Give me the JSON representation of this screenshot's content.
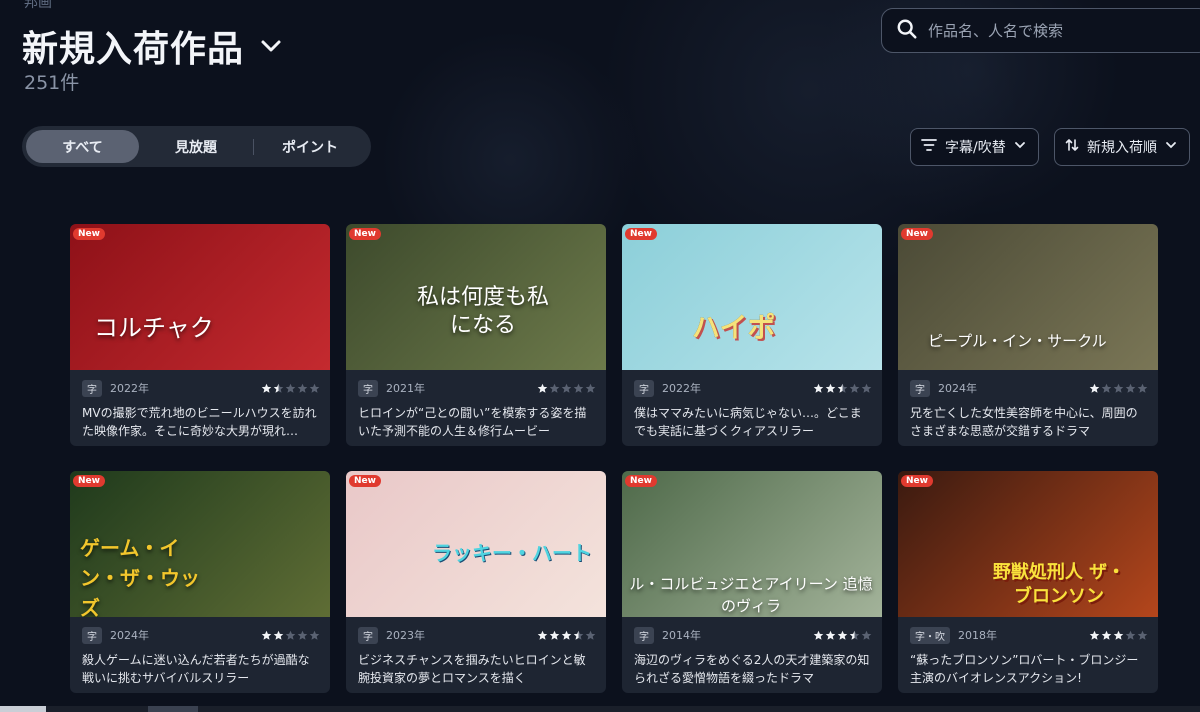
{
  "header": {
    "crumb": "邦画",
    "title": "新規入荷作品",
    "count": "251件"
  },
  "search": {
    "placeholder": "作品名、人名で検索"
  },
  "tabs": [
    {
      "label": "すべて",
      "active": true
    },
    {
      "label": "見放題",
      "active": false
    },
    {
      "label": "ポイント",
      "active": false
    }
  ],
  "filters": {
    "subtitle_label": "字幕/吹替",
    "sort_label": "新規入荷順"
  },
  "cards": [
    {
      "badge": "New",
      "thumb_title": "コルチャク",
      "sub": "字",
      "year": "2022年",
      "rating": 1.5,
      "desc": "MVの撮影で荒れ地のビニールハウスを訪れた映像作家。そこに奇妙な大男が現れ…",
      "colors": [
        "#8e1118",
        "#c42a2f"
      ]
    },
    {
      "badge": "New",
      "thumb_title": "私は何度も私になる",
      "sub": "字",
      "year": "2021年",
      "rating": 1,
      "desc": "ヒロインが“己との闘い”を模索する姿を描いた予測不能の人生＆修行ムービー",
      "colors": [
        "#3d4a2c",
        "#6d7a4b"
      ]
    },
    {
      "badge": "New",
      "thumb_title": "ハイポ",
      "sub": "字",
      "year": "2022年",
      "rating": 2.5,
      "desc": "僕はママみたいに病気じゃない…。どこまでも実話に基づくクィアスリラー",
      "colors": [
        "#8ccfd9",
        "#b7e3ea"
      ]
    },
    {
      "badge": "New",
      "thumb_title": "ピープル・イン・サークル",
      "sub": "字",
      "year": "2024年",
      "rating": 1,
      "desc": "兄を亡くした女性美容師を中心に、周囲のさまざまな思惑が交錯するドラマ",
      "colors": [
        "#4b4a36",
        "#7a7656"
      ]
    },
    {
      "badge": "New",
      "thumb_title": "ゲーム・イン・ザ・ウッズ",
      "sub": "字",
      "year": "2024年",
      "rating": 2,
      "desc": "殺人ゲームに迷い込んだ若者たちが過酷な戦いに挑むサバイバルスリラー",
      "colors": [
        "#1f3a1c",
        "#5f6d35"
      ]
    },
    {
      "badge": "New",
      "thumb_title": "ラッキー・ハート",
      "sub": "字",
      "year": "2023年",
      "rating": 3.5,
      "desc": "ビジネスチャンスを掴みたいヒロインと敏腕投資家の夢とロマンスを描く",
      "colors": [
        "#e9c8c8",
        "#f4e3dc"
      ]
    },
    {
      "badge": "New",
      "thumb_title": "ル・コルビュジエとアイリーン 追憶のヴィラ",
      "sub": "字",
      "year": "2014年",
      "rating": 3.5,
      "desc": "海辺のヴィラをめぐる2人の天才建築家の知られざる愛憎物語を綴ったドラマ",
      "colors": [
        "#4f6a4a",
        "#a3b39a"
      ]
    },
    {
      "badge": "New",
      "thumb_title": "野獣処刑人 ザ・ブロンソン",
      "sub": "字・吹",
      "year": "2018年",
      "rating": 3,
      "desc": "“蘇ったブロンソン”ロバート・ブロンジー主演のバイオレンスアクション!",
      "colors": [
        "#3a1a10",
        "#b4461c"
      ]
    }
  ]
}
